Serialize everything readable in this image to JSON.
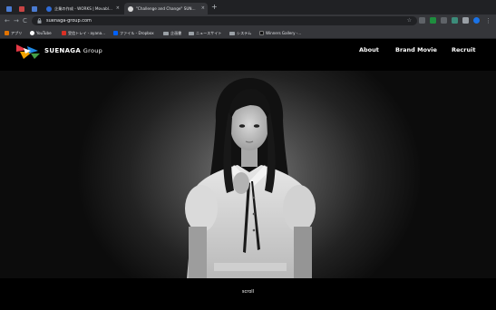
{
  "browser": {
    "tabs": [
      {
        "title": "",
        "favicon_color": "#4a7bd1"
      },
      {
        "title": "",
        "favicon_color": "#c94444"
      },
      {
        "title": "",
        "favicon_color": "#4a7bd1"
      },
      {
        "title": "企業の作成 - WORKS | Movabl...",
        "favicon_color": "#2f6bd6",
        "close": "×"
      },
      {
        "title": "\"Challenge and Change\" SUN...",
        "favicon_color": "#d8d8d8",
        "close": "×"
      }
    ],
    "new_tab": "+",
    "url": "suenaga-group.com",
    "nav": {
      "back": "←",
      "forward": "→",
      "reload": "C"
    },
    "bookmarks": [
      {
        "label": "アプリ",
        "icon": "apps-icon",
        "color": "#e37400"
      },
      {
        "label": "YouTube",
        "icon": "youtube-icon",
        "color": "#ffffff"
      },
      {
        "label": "受信トレイ - ayana...",
        "icon": "gmail-icon",
        "color": "#d93025"
      },
      {
        "label": "ファイル - Dropbox",
        "icon": "dropbox-icon",
        "color": "#0061fe"
      },
      {
        "label": "企画書",
        "icon": "folder-icon"
      },
      {
        "label": "ニュースサイト",
        "icon": "folder-icon"
      },
      {
        "label": "システム",
        "icon": "folder-icon"
      },
      {
        "label": "Winners Gallery -...",
        "icon": "site-icon",
        "color": "#222222"
      }
    ],
    "extension_colors": [
      "#5f6368",
      "#1e8e3e",
      "#5f6368",
      "#3c8c7a",
      "#9aa0a6",
      "#1a73e8"
    ]
  },
  "site": {
    "brand_name": "SUENAGA",
    "brand_suffix": "Group",
    "nav": [
      "About",
      "Brand Movie",
      "Recruit"
    ],
    "scroll_label": "scroll",
    "logo_colors": [
      "#e63946",
      "#f4a300",
      "#1e88e5",
      "#43a047",
      "#ffffff"
    ]
  }
}
